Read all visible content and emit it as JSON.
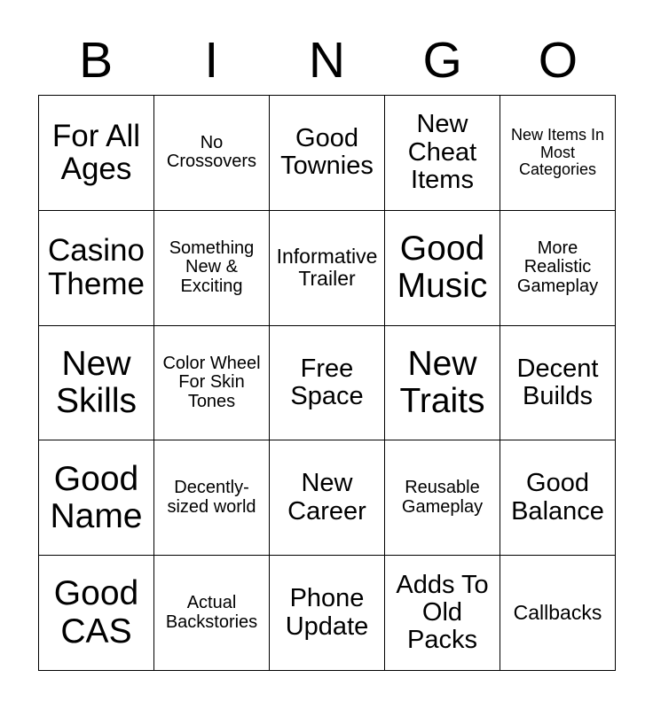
{
  "card": {
    "title": "BINGO",
    "header_letters": [
      "B",
      "I",
      "N",
      "G",
      "O"
    ],
    "columns": 5,
    "rows": 5,
    "free_space_text": "Free Space",
    "free_space_position": {
      "row": 3,
      "column": 3
    },
    "colors": {
      "background": "#ffffff",
      "cell_background": "#ffffff",
      "grid_line": "#000000",
      "text": "#000000"
    },
    "grid": [
      [
        {
          "text": "For All Ages",
          "size": "lg"
        },
        {
          "text": "No Crossovers",
          "size": "xs"
        },
        {
          "text": "Good Townies",
          "size": "md"
        },
        {
          "text": "New Cheat Items",
          "size": "md"
        },
        {
          "text": "New Items In Most Categories",
          "size": "xxs"
        }
      ],
      [
        {
          "text": "Casino Theme",
          "size": "lg"
        },
        {
          "text": "Something New & Exciting",
          "size": "xs"
        },
        {
          "text": "Informative Trailer",
          "size": "sm"
        },
        {
          "text": "Good Music",
          "size": "xl"
        },
        {
          "text": "More Realistic Gameplay",
          "size": "xs"
        }
      ],
      [
        {
          "text": "New Skills",
          "size": "xl"
        },
        {
          "text": "Color Wheel For Skin Tones",
          "size": "xs"
        },
        {
          "text": "Free Space",
          "size": "md"
        },
        {
          "text": "New Traits",
          "size": "xl"
        },
        {
          "text": "Decent Builds",
          "size": "md"
        }
      ],
      [
        {
          "text": "Good Name",
          "size": "xl"
        },
        {
          "text": "Decently-sized world",
          "size": "xs"
        },
        {
          "text": "New Career",
          "size": "md"
        },
        {
          "text": "Reusable Gameplay",
          "size": "xs"
        },
        {
          "text": "Good Balance",
          "size": "md"
        }
      ],
      [
        {
          "text": "Good CAS",
          "size": "xl"
        },
        {
          "text": "Actual Backstories",
          "size": "xs"
        },
        {
          "text": "Phone Update",
          "size": "md"
        },
        {
          "text": "Adds To Old Packs",
          "size": "md"
        },
        {
          "text": "Callbacks",
          "size": "sm"
        }
      ]
    ]
  }
}
